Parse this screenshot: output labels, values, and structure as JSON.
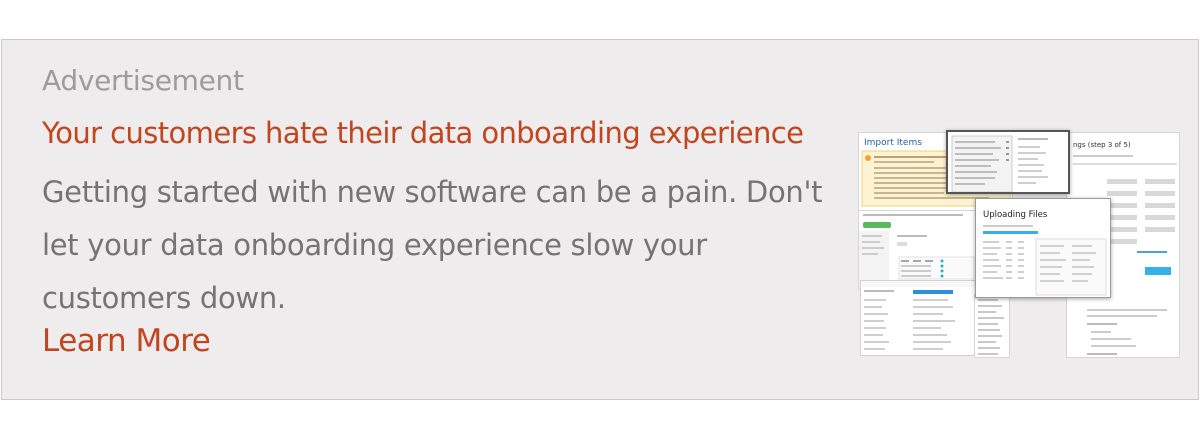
{
  "ad": {
    "label": "Advertisement",
    "headline": "Your customers hate their data onboarding experience",
    "body": "Getting started with new software can be a pain. Don't let your data onboarding experience slow your customers down.",
    "cta": "Learn More"
  },
  "collage": {
    "import_title": "Import Items",
    "uploading_title": "Uploading Files",
    "mapping_title": "ngs (step 3 of 5)"
  },
  "colors": {
    "headline": "#c1461f",
    "label": "#9c9c9c",
    "body": "#747474",
    "background": "#eeecec"
  }
}
